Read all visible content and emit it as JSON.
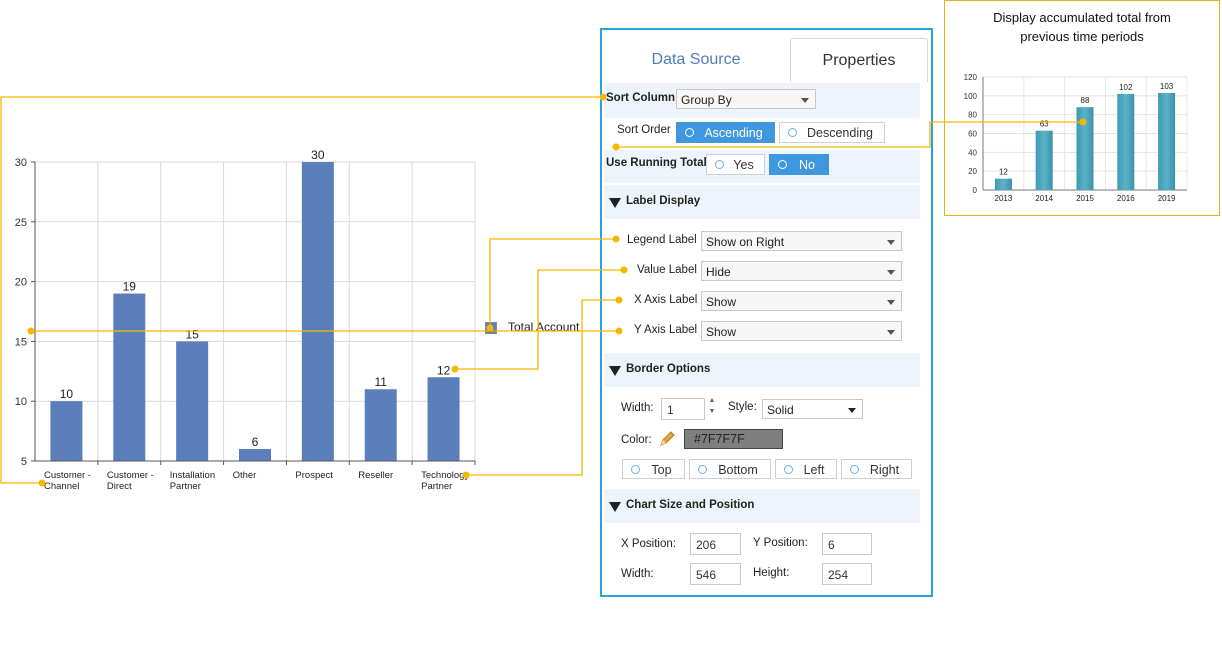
{
  "main_chart": {
    "legend_label": "Total Account",
    "colors": {
      "bar": "#5a7fbb",
      "grid": "#d9d9d9",
      "connector": "#f5b800"
    }
  },
  "chart_data": [
    {
      "type": "bar",
      "categories": [
        "Customer - Channel",
        "Customer - Direct",
        "Installation Partner",
        "Other",
        "Prospect",
        "Reseller",
        "Technology Partner"
      ],
      "category_lines": [
        [
          "Customer -",
          "Channel"
        ],
        [
          "Customer -",
          "Direct"
        ],
        [
          "Installation",
          "Partner"
        ],
        [
          "Other"
        ],
        [
          "Prospect"
        ],
        [
          "Reseller"
        ],
        [
          "Technology",
          "Partner"
        ]
      ],
      "series": [
        {
          "name": "Total Account",
          "values": [
            10,
            19,
            15,
            6,
            30,
            11,
            12
          ]
        }
      ],
      "ylim": [
        5,
        30
      ],
      "yticks": [
        5,
        10,
        15,
        20,
        25,
        30
      ],
      "grid": true,
      "legend": "right"
    },
    {
      "type": "bar",
      "title": "Display accumulated total from previous time periods",
      "categories": [
        "2013",
        "2014",
        "2015",
        "2016",
        "2019"
      ],
      "values": [
        12,
        63,
        88,
        102,
        103
      ],
      "ylim": [
        0,
        120
      ],
      "yticks": [
        0,
        20,
        40,
        60,
        80,
        100,
        120
      ],
      "grid": true
    }
  ],
  "inset": {
    "caption_line1": "Display accumulated total from",
    "caption_line2": "previous time periods",
    "bar_color": "#5bb3c8"
  },
  "panel": {
    "tabs": {
      "data_source": "Data Source",
      "properties": "Properties"
    },
    "sort_column": {
      "label": "Sort Column",
      "value": "Group By"
    },
    "sort_order": {
      "label": "Sort Order",
      "ascending": "Ascending",
      "descending": "Descending",
      "selected": "Ascending"
    },
    "running_total": {
      "label": "Use Running Total",
      "yes": "Yes",
      "no": "No",
      "selected": "No"
    },
    "label_display": {
      "title": "Label Display",
      "legend_label": {
        "label": "Legend Label",
        "value": "Show on Right"
      },
      "value_label": {
        "label": "Value Label",
        "value": "Hide"
      },
      "x_axis_label": {
        "label": "X Axis Label",
        "value": "Show"
      },
      "y_axis_label": {
        "label": "Y Axis Label",
        "value": "Show"
      }
    },
    "border_options": {
      "title": "Border Options",
      "width_label": "Width:",
      "width_value": "1",
      "style_label": "Style:",
      "style_value": "Solid",
      "color_label": "Color:",
      "color_value": "#7F7F7F",
      "sides": {
        "top": "Top",
        "bottom": "Bottom",
        "left": "Left",
        "right": "Right"
      }
    },
    "chart_size": {
      "title": "Chart Size and Position",
      "x_label": "X Position:",
      "x_value": "206",
      "y_label": "Y Position:",
      "y_value": "6",
      "w_label": "Width:",
      "w_value": "546",
      "h_label": "Height:",
      "h_value": "254"
    }
  },
  "icons": {
    "color_picker": "pencil-icon",
    "section_toggle": "triangle-down-icon",
    "dropdown": "chevron-down-icon"
  }
}
